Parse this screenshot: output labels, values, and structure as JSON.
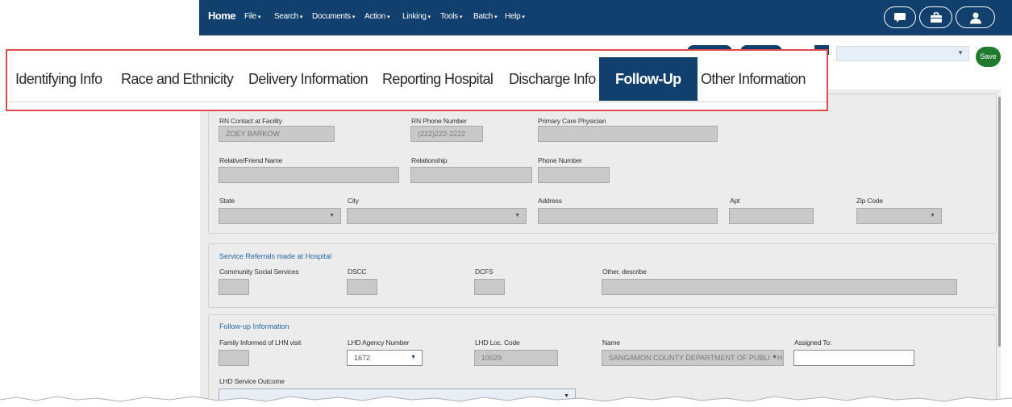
{
  "nav": {
    "home": "Home",
    "items": [
      {
        "label": "File"
      },
      {
        "label": "Search"
      },
      {
        "label": "Documents"
      },
      {
        "label": "Action"
      },
      {
        "label": "Linking"
      },
      {
        "label": "Tools"
      },
      {
        "label": "Batch"
      },
      {
        "label": "Help"
      }
    ],
    "right_icons": [
      "chat-icon",
      "briefcase-icon",
      "user-icon"
    ]
  },
  "tabs": [
    {
      "label": "Identifying Info"
    },
    {
      "label": "Race and Ethnicity"
    },
    {
      "label": "Delivery Information"
    },
    {
      "label": "Reporting Hospital"
    },
    {
      "label": "Discharge Info"
    },
    {
      "label": "Follow-Up",
      "active": true
    },
    {
      "label": "Other Information"
    }
  ],
  "toolbar": {
    "select_value": "",
    "save_label": "Save"
  },
  "contact": {
    "rn_contact_label": "RN Contact at Facility",
    "rn_contact_value": "ZOEY BARKOW",
    "rn_phone_label": "RN Phone Number",
    "rn_phone_value": "(222)222-2222",
    "pcp_label": "Primary Care Physician",
    "pcp_value": "",
    "relative_label": "Relative/Friend Name",
    "relationship_label": "Relationship",
    "phone_label": "Phone Number",
    "state_label": "State",
    "city_label": "City",
    "address_label": "Address",
    "apt_label": "Apt",
    "zip_label": "Zip Code"
  },
  "referrals": {
    "title": "Service Referrals made at Hospital",
    "community_label": "Community Social Services",
    "dscc_label": "DSCC",
    "dcfs_label": "DCFS",
    "other_label": "Other, describe"
  },
  "followup": {
    "title": "Follow-up Information",
    "family_label": "Family Informed of LHN visit",
    "agency_label": "LHD Agency Number",
    "agency_value": "1672",
    "loc_label": "LHD Loc. Code",
    "loc_value": "10029",
    "name_label": "Name",
    "name_value": "SANGAMON COUNTY DEPARTMENT OF PUBLIC HEALTH",
    "assigned_label": "Assigned To:",
    "assigned_value": "",
    "outcome_label": "LHD Service Outcome"
  },
  "colors": {
    "nav_bg": "#12406e",
    "highlight_border": "#e04a4a",
    "save_green": "#1f7a2e",
    "section_title": "#2368a8"
  }
}
